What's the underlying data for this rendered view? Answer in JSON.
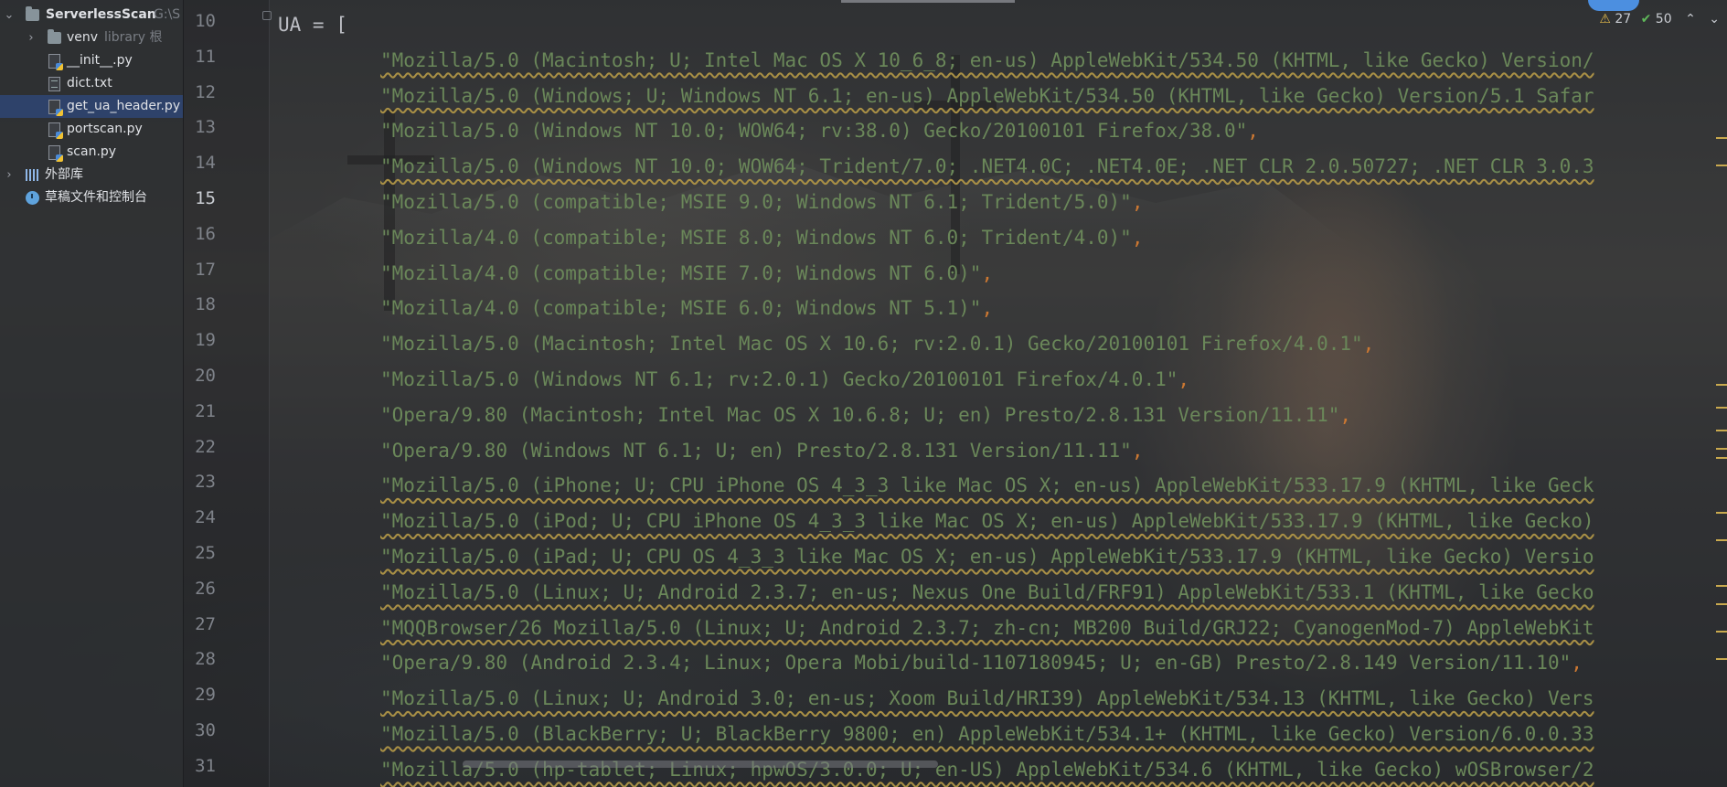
{
  "project": {
    "root_name": "ServerlessScan",
    "root_path": "G:\\S",
    "items": [
      {
        "label": "venv",
        "suffix": "library 根"
      },
      {
        "label": "__init__.py"
      },
      {
        "label": "dict.txt"
      },
      {
        "label": "get_ua_header.py"
      },
      {
        "label": "portscan.py"
      },
      {
        "label": "scan.py"
      },
      {
        "label": "外部库"
      },
      {
        "label": "草稿文件和控制台"
      }
    ]
  },
  "inspections": {
    "warnings": "27",
    "ok": "50"
  },
  "editor": {
    "current_line": 15,
    "lines": [
      {
        "n": "10",
        "text": "UA = [",
        "tail": ""
      },
      {
        "n": "11",
        "text": "\"Mozilla/5.0 (Macintosh; U; Intel Mac OS X 10_6_8; en-us) AppleWebKit/534.50 (KHTML, like Gecko) Version/",
        "tail": ""
      },
      {
        "n": "12",
        "text": "\"Mozilla/5.0 (Windows; U; Windows NT 6.1; en-us) AppleWebKit/534.50 (KHTML, like Gecko) Version/5.1 Safar",
        "tail": ""
      },
      {
        "n": "13",
        "text": "\"Mozilla/5.0 (Windows NT 10.0; WOW64; rv:38.0) Gecko/20100101 Firefox/38.0\"",
        "tail": ","
      },
      {
        "n": "14",
        "text": "\"Mozilla/5.0 (Windows NT 10.0; WOW64; Trident/7.0; .NET4.0C; .NET4.0E; .NET CLR 2.0.50727; .NET CLR 3.0.3",
        "tail": ""
      },
      {
        "n": "15",
        "text": "\"Mozilla/5.0 (compatible; MSIE 9.0; Windows NT 6.1; Trident/5.0)\"",
        "tail": ","
      },
      {
        "n": "16",
        "text": "\"Mozilla/4.0 (compatible; MSIE 8.0; Windows NT 6.0; Trident/4.0)\"",
        "tail": ","
      },
      {
        "n": "17",
        "text": "\"Mozilla/4.0 (compatible; MSIE 7.0; Windows NT 6.0)\"",
        "tail": ","
      },
      {
        "n": "18",
        "text": "\"Mozilla/4.0 (compatible; MSIE 6.0; Windows NT 5.1)\"",
        "tail": ","
      },
      {
        "n": "19",
        "text": "\"Mozilla/5.0 (Macintosh; Intel Mac OS X 10.6; rv:2.0.1) Gecko/20100101 Firefox/4.0.1\"",
        "tail": ","
      },
      {
        "n": "20",
        "text": "\"Mozilla/5.0 (Windows NT 6.1; rv:2.0.1) Gecko/20100101 Firefox/4.0.1\"",
        "tail": ","
      },
      {
        "n": "21",
        "text": "\"Opera/9.80 (Macintosh; Intel Mac OS X 10.6.8; U; en) Presto/2.8.131 Version/11.11\"",
        "tail": ","
      },
      {
        "n": "22",
        "text": "\"Opera/9.80 (Windows NT 6.1; U; en) Presto/2.8.131 Version/11.11\"",
        "tail": ","
      },
      {
        "n": "23",
        "text": "\"Mozilla/5.0 (iPhone; U; CPU iPhone OS 4_3_3 like Mac OS X; en-us) AppleWebKit/533.17.9 (KHTML, like Geck",
        "tail": ""
      },
      {
        "n": "24",
        "text": "\"Mozilla/5.0 (iPod; U; CPU iPhone OS 4_3_3 like Mac OS X; en-us) AppleWebKit/533.17.9 (KHTML, like Gecko)",
        "tail": ""
      },
      {
        "n": "25",
        "text": "\"Mozilla/5.0 (iPad; U; CPU OS 4_3_3 like Mac OS X; en-us) AppleWebKit/533.17.9 (KHTML, like Gecko) Versio",
        "tail": ""
      },
      {
        "n": "26",
        "text": "\"Mozilla/5.0 (Linux; U; Android 2.3.7; en-us; Nexus One Build/FRF91) AppleWebKit/533.1 (KHTML, like Gecko",
        "tail": ""
      },
      {
        "n": "27",
        "text": "\"MQQBrowser/26 Mozilla/5.0 (Linux; U; Android 2.3.7; zh-cn; MB200 Build/GRJ22; CyanogenMod-7) AppleWebKit",
        "tail": ""
      },
      {
        "n": "28",
        "text": "\"Opera/9.80 (Android 2.3.4; Linux; Opera Mobi/build-1107180945; U; en-GB) Presto/2.8.149 Version/11.10\"",
        "tail": ","
      },
      {
        "n": "29",
        "text": "\"Mozilla/5.0 (Linux; U; Android 3.0; en-us; Xoom Build/HRI39) AppleWebKit/534.13 (KHTML, like Gecko) Vers",
        "tail": ""
      },
      {
        "n": "30",
        "text": "\"Mozilla/5.0 (BlackBerry; U; BlackBerry 9800; en) AppleWebKit/534.1+ (KHTML, like Gecko) Version/6.0.0.33",
        "tail": ""
      },
      {
        "n": "31",
        "text": "\"Mozilla/5.0 (hp-tablet; Linux; hpwOS/3.0.0; U; en-US) AppleWebKit/534.6 (KHTML, like Gecko) wOSBrowser/2",
        "tail": ""
      }
    ]
  }
}
